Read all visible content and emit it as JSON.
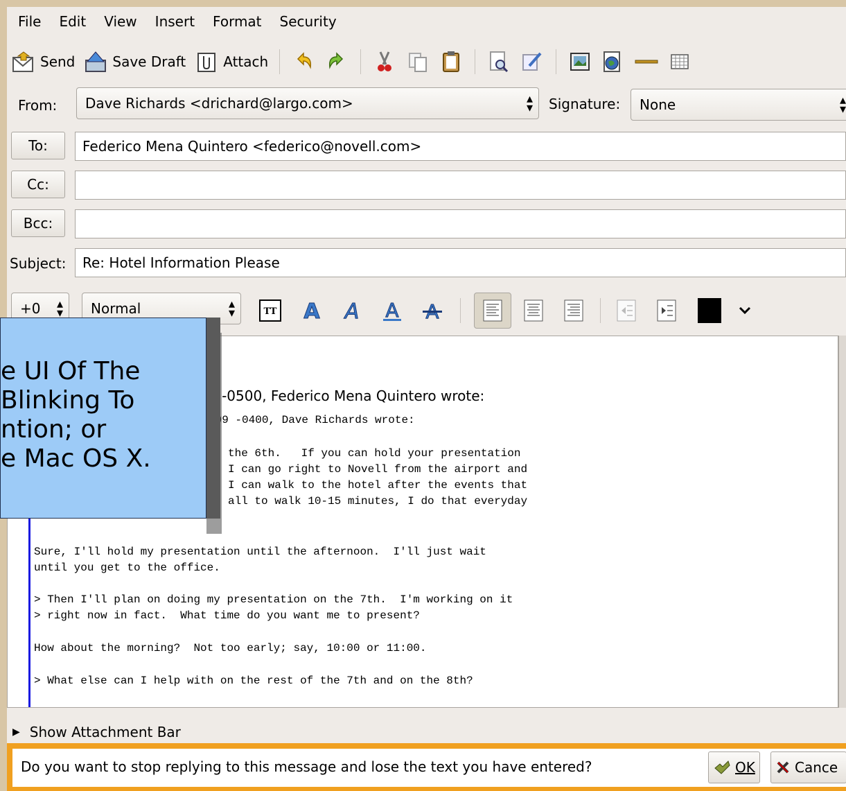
{
  "menu": [
    "File",
    "Edit",
    "View",
    "Insert",
    "Format",
    "Security"
  ],
  "toolbar": {
    "send": "Send",
    "save_draft": "Save Draft",
    "attach": "Attach"
  },
  "from": {
    "label": "From:",
    "value": "Dave Richards <drichard@largo.com>",
    "signature_label": "Signature:",
    "signature_value": "None"
  },
  "to": {
    "label": "To:",
    "value": "Federico Mena Quintero <federico@novell.com>"
  },
  "cc": {
    "label": "Cc:",
    "value": ""
  },
  "bcc": {
    "label": "Bcc:",
    "value": ""
  },
  "subject": {
    "label": "Subject:",
    "value": "Re: Hotel Information Please"
  },
  "format": {
    "size": "+0",
    "style": "Normal",
    "color": "#000000"
  },
  "body": {
    "header1": "0 -0500, Federico Mena Quintero wrote:",
    "header2": ":09 -0400, Dave Richards wrote:",
    "q1": "the 6th.   If you can hold your presentation",
    "q2": "I can go right to Novell from the airport and",
    "q3": "I can walk to the hotel after the events that",
    "q4": "all to walk 10-15 minutes, I do that everyday",
    "r1": "Sure, I'll hold my presentation until the afternoon.  I'll just wait",
    "r2": "until you get to the office.",
    "q5": "> Then I'll plan on doing my presentation on the 7th.  I'm working on it",
    "q6": "> right now in fact.  What time do you want me to present?",
    "r3": "How about the morning?  Not too early; say, 10:00 or 11:00.",
    "q7": "> What else can I help with on the rest of the 7th and on the 8th?"
  },
  "tooltip": [
    "e UI Of The",
    "Blinking To",
    "ntion; or",
    "e Mac OS X."
  ],
  "attachment_bar": "Show Attachment Bar",
  "alert": {
    "text": "Do you want to stop replying to this message and lose the text you have entered?",
    "ok": "OK",
    "cancel": "Cance"
  }
}
